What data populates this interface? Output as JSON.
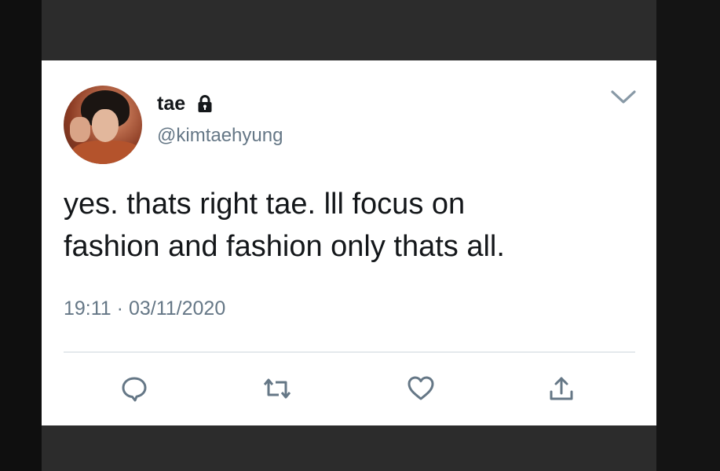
{
  "tweet": {
    "display_name": "tae",
    "handle": "@kimtaehyung",
    "text_line1": "yes. thats right tae. lll focus on",
    "text_line2": "fashion and fashion only thats all.",
    "time": "19:11",
    "separator": "·",
    "date": "03/11/2020",
    "protected_icon": "lock-icon",
    "menu_icon": "chevron-down-icon"
  },
  "actions": [
    {
      "name": "reply",
      "icon": "comment-icon"
    },
    {
      "name": "retweet",
      "icon": "retweet-icon"
    },
    {
      "name": "like",
      "icon": "heart-icon"
    },
    {
      "name": "share",
      "icon": "share-icon"
    }
  ],
  "colors": {
    "text_primary": "#14171a",
    "text_secondary": "#657786",
    "icon": "#657786",
    "card_background": "#ffffff",
    "frame_background": "#2c2c2c"
  }
}
